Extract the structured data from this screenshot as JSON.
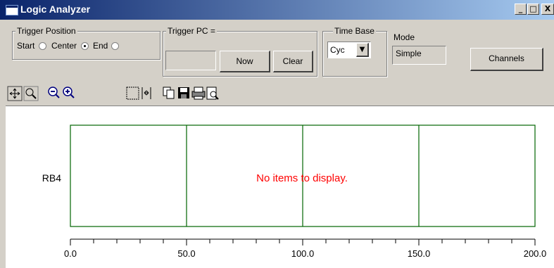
{
  "window": {
    "title": "Logic Analyzer",
    "min_glyph": "_",
    "max_glyph": "□",
    "close_glyph": "X"
  },
  "trigger_position": {
    "label": "Trigger Position",
    "options": [
      {
        "label": "Start",
        "selected": false
      },
      {
        "label": "Center",
        "selected": true
      },
      {
        "label": "End",
        "selected": false
      }
    ]
  },
  "trigger_pc": {
    "label": "Trigger PC =",
    "value": "",
    "now_label": "Now",
    "clear_label": "Clear"
  },
  "time_base": {
    "label": "Time Base",
    "value": "Cyc"
  },
  "mode": {
    "label": "Mode",
    "value": "Simple"
  },
  "channels_label": "Channels",
  "toolbar_icons": [
    "pan-icon",
    "zoom-select-icon",
    "zoom-out-icon",
    "zoom-in-icon",
    "select-region-icon",
    "fit-marker-icon",
    "copy-icon",
    "save-icon",
    "print-icon",
    "print-preview-icon"
  ],
  "plot": {
    "signal_label": "RB4",
    "empty_message": "No items to display.",
    "axis_color": "#006400",
    "message_color": "#ff0000"
  },
  "chart_data": {
    "type": "line",
    "series": [
      {
        "name": "RB4",
        "values": []
      }
    ],
    "xlim": [
      0,
      200
    ],
    "xticks": [
      "0.0",
      "50.0",
      "100.0",
      "150.0",
      "200.0"
    ],
    "grid": true
  }
}
